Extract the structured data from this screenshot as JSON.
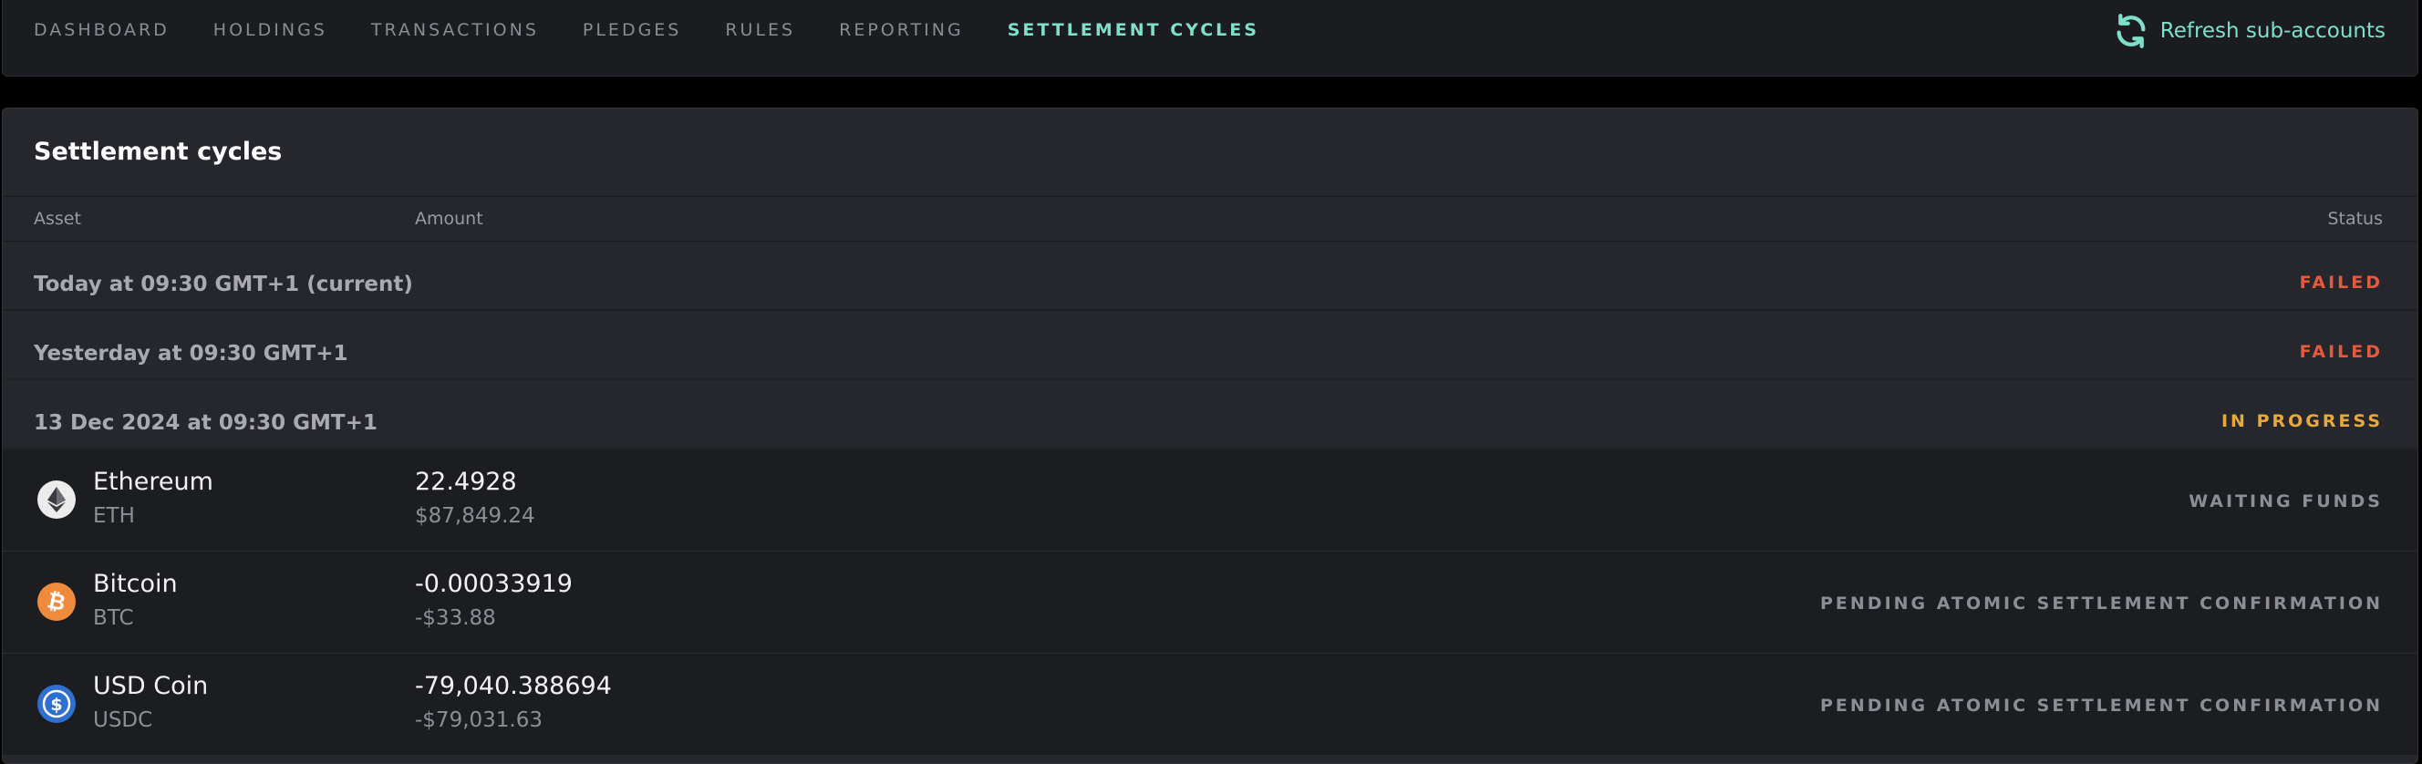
{
  "nav": {
    "items": [
      {
        "label": "DASHBOARD"
      },
      {
        "label": "HOLDINGS"
      },
      {
        "label": "TRANSACTIONS"
      },
      {
        "label": "PLEDGES"
      },
      {
        "label": "RULES"
      },
      {
        "label": "REPORTING"
      },
      {
        "label": "SETTLEMENT CYCLES"
      }
    ],
    "active_index": 6,
    "refresh_label": "Refresh sub-accounts",
    "refresh_icon": "refresh-icon"
  },
  "panel": {
    "title": "Settlement cycles",
    "columns": {
      "asset": "Asset",
      "amount": "Amount",
      "status": "Status"
    },
    "cycles": [
      {
        "date": "Today at 09:30 GMT+1 (current)",
        "status": "FAILED"
      },
      {
        "date": "Yesterday at 09:30 GMT+1",
        "status": "FAILED"
      },
      {
        "date": "13 Dec 2024 at 09:30 GMT+1",
        "status": "IN PROGRESS"
      }
    ],
    "assets": [
      {
        "name": "Ethereum",
        "symbol": "ETH",
        "amount": "22.4928",
        "usd": "$87,849.24",
        "status": "WAITING FUNDS",
        "icon": "ethereum-icon"
      },
      {
        "name": "Bitcoin",
        "symbol": "BTC",
        "amount": "-0.00033919",
        "usd": "-$33.88",
        "status": "PENDING ATOMIC SETTLEMENT CONFIRMATION",
        "icon": "bitcoin-icon"
      },
      {
        "name": "USD Coin",
        "symbol": "USDC",
        "amount": "-79,040.388694",
        "usd": "-$79,031.63",
        "status": "PENDING ATOMIC SETTLEMENT CONFIRMATION",
        "icon": "usdc-icon"
      }
    ]
  },
  "colors": {
    "accent": "#7ee0c9",
    "failed": "#e5593f",
    "in_progress": "#e8a93a",
    "eth": "#ececec",
    "btc": "#f08a3c",
    "usdc": "#2f6fd0"
  }
}
